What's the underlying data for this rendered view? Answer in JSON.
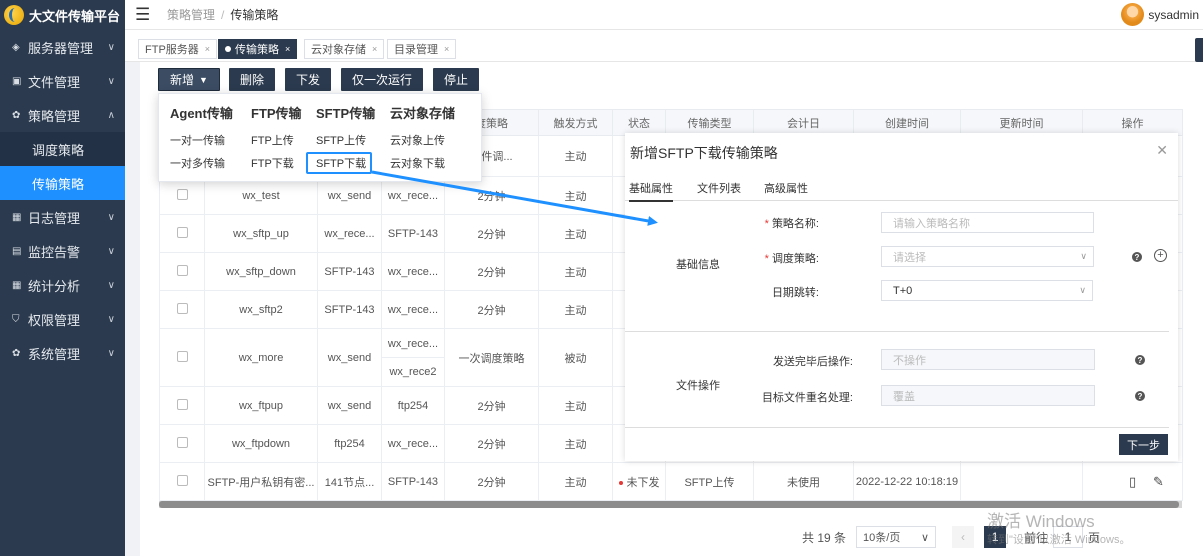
{
  "app": {
    "title": "大文件传输平台"
  },
  "sidebar": {
    "items": [
      {
        "label": "服务器管理",
        "icon": "cube-icon"
      },
      {
        "label": "文件管理",
        "icon": "truck-icon"
      },
      {
        "label": "策略管理",
        "icon": "gear-icon",
        "expanded": true,
        "children": [
          "调度策略",
          "传输策略"
        ]
      },
      {
        "label": "日志管理",
        "icon": "grid-icon"
      },
      {
        "label": "监控告警",
        "icon": "monitor-icon"
      },
      {
        "label": "统计分析",
        "icon": "grid-icon"
      },
      {
        "label": "权限管理",
        "icon": "shield-icon"
      },
      {
        "label": "系统管理",
        "icon": "gear-icon"
      }
    ],
    "active_child": "传输策略"
  },
  "header": {
    "breadcrumb": [
      "策略管理",
      "传输策略"
    ],
    "user": "sysadmin"
  },
  "tabs": [
    {
      "label": "FTP服务器",
      "active": false
    },
    {
      "label": "传输策略",
      "active": true
    },
    {
      "label": "云对象存储",
      "active": false
    },
    {
      "label": "目录管理",
      "active": false
    }
  ],
  "toolbar": {
    "new_label": "新增",
    "delete_label": "删除",
    "dispatch_label": "下发",
    "run_once_label": "仅一次运行",
    "stop_label": "停止"
  },
  "dropdown": {
    "columns": [
      {
        "head": "Agent传输",
        "items": [
          "一对一传输",
          "一对多传输"
        ]
      },
      {
        "head": "FTP传输",
        "items": [
          "FTP上传",
          "FTP下载"
        ]
      },
      {
        "head": "SFTP传输",
        "items": [
          "SFTP上传",
          "SFTP下载"
        ]
      },
      {
        "head": "云对象存储",
        "items": [
          "云对象上传",
          "云对象下载"
        ]
      }
    ],
    "highlighted": "SFTP下载"
  },
  "table": {
    "headers": [
      "",
      "",
      "",
      "",
      "度策略",
      "触发方式",
      "状态",
      "传输类型",
      "会计日",
      "创建时间",
      "更新时间",
      "操作"
    ],
    "rows": [
      [
        "",
        "",
        "",
        "",
        "文件调...",
        "主动",
        "",
        "",
        "",
        "",
        "",
        ""
      ],
      [
        "",
        "wx_test",
        "wx_send",
        "wx_rece...",
        "2分钟",
        "主动",
        "",
        "",
        "",
        "",
        "",
        ""
      ],
      [
        "",
        "wx_sftp_up",
        "wx_rece...",
        "SFTP-143",
        "2分钟",
        "主动",
        "",
        "",
        "",
        "",
        "",
        ""
      ],
      [
        "",
        "wx_sftp_down",
        "SFTP-143",
        "wx_rece...",
        "2分钟",
        "主动",
        "",
        "",
        "",
        "",
        "",
        ""
      ],
      [
        "",
        "wx_sftp2",
        "SFTP-143",
        "wx_rece...",
        "2分钟",
        "主动",
        "",
        "",
        "",
        "",
        "",
        ""
      ],
      [
        "",
        "wx_more",
        "wx_send",
        "wx_rece...|wx_rece2",
        "一次调度策略",
        "被动",
        "",
        "",
        "",
        "",
        "",
        ""
      ],
      [
        "",
        "wx_ftpup",
        "wx_send",
        "ftp254",
        "2分钟",
        "主动",
        "",
        "",
        "",
        "",
        "",
        ""
      ],
      [
        "",
        "wx_ftpdown",
        "ftp254",
        "wx_rece...",
        "2分钟",
        "主动",
        "",
        "",
        "",
        "",
        "",
        ""
      ],
      [
        "",
        "SFTP-用户私钥有密...",
        "141节点...",
        "SFTP-143",
        "2分钟",
        "主动",
        "未下发",
        "SFTP上传",
        "未使用",
        "2022-12-22 10:18:19",
        "",
        ""
      ]
    ]
  },
  "pagination": {
    "total": "共 19 条",
    "page_size": "10条/页",
    "current": "1",
    "goto_label": "前往",
    "goto_value": "1",
    "page_suffix": "页"
  },
  "modal": {
    "title": "新增SFTP下载传输策略",
    "tabs": [
      "基础属性",
      "文件列表",
      "高级属性"
    ],
    "section_basic": "基础信息",
    "section_file": "文件操作",
    "fields": {
      "name_label": "策略名称:",
      "name_placeholder": "请输入策略名称",
      "schedule_label": "调度策略:",
      "schedule_placeholder": "请选择",
      "date_label": "日期跳转:",
      "date_value": "T+0",
      "after_send_label": "发送完毕后操作:",
      "after_send_value": "不操作",
      "rename_label": "目标文件重名处理:",
      "rename_value": "覆盖"
    },
    "next_label": "下一步"
  },
  "watermark": {
    "line1": "激活 Windows",
    "line2": "转到\"设置\"以激活 Windows。"
  },
  "colors": {
    "sidebar": "#2b3a4e",
    "accent": "#1e90ff",
    "status_red": "#e53935"
  }
}
